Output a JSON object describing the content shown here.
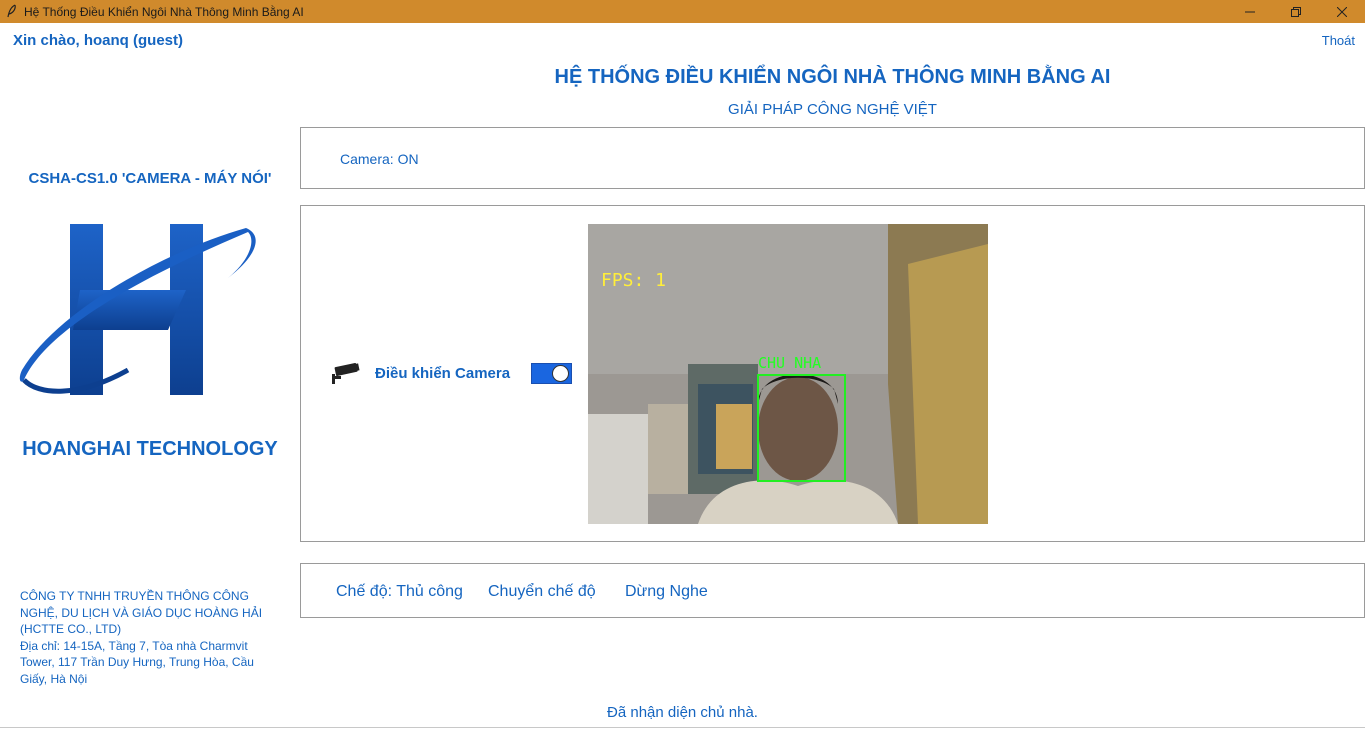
{
  "window": {
    "title": "Hệ Thống Điều Khiển Ngôi Nhà Thông Minh Bằng AI",
    "app_icon": "feather-icon",
    "titlebar_color": "#d08a2c"
  },
  "header": {
    "greeting": "Xin chào, hoanq (guest)",
    "logout_label": "Thoát",
    "title": "HỆ THỐNG ĐIỀU KHIỂN NGÔI NHÀ THÔNG MINH BẰNG AI",
    "subtitle": "GIẢI PHÁP CÔNG NGHỆ VIỆT"
  },
  "sidebar": {
    "model": "CSHA-CS1.0 'CAMERA - MÁY NÓI'",
    "logo": "hoanghai-h-logo",
    "brand": "HOANGHAI TECHNOLOGY",
    "company_lines": [
      "CÔNG TY TNHH TRUYỀN THÔNG CÔNG",
      "NGHỆ, DU LỊCH VÀ GIÁO DỤC HOÀNG HẢI",
      "(HCTTE CO., LTD)",
      "Địa chỉ: 14-15A, Tầng 7, Tòa nhà Charmvit",
      "Tower, 117 Trần Duy Hưng, Trung Hòa, Cầu",
      "Giấy, Hà Nội"
    ]
  },
  "camera_status": {
    "text": "Camera: ON"
  },
  "camera_control": {
    "icon": "security-camera-icon",
    "label": "Điều khiển Camera",
    "toggle_on": true,
    "accent": "#1a66e0"
  },
  "camera_feed": {
    "fps_text": "FPS: 1",
    "face_label": "CHU NHA",
    "overlay_fps_color": "#ffee3a",
    "overlay_face_color": "#22ee22"
  },
  "modes": {
    "mode_label": "Chế độ: Thủ công",
    "switch_label": "Chuyển chế độ",
    "stop_label": "Dừng Nghe"
  },
  "status": {
    "message": "Đã nhận diện chủ nhà."
  },
  "accent_color": "#1565c0"
}
